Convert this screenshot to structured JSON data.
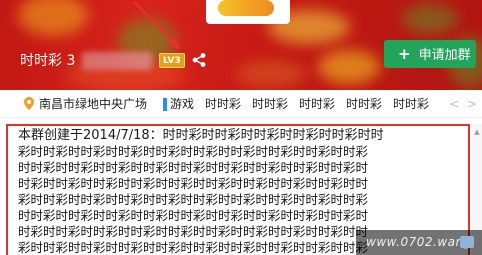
{
  "group": {
    "name_prefix": "时时彩 3",
    "level": "LV3",
    "join_label": "申请加群"
  },
  "tags": {
    "location": "南昌市绿地中央广场",
    "items": [
      "游戏",
      "时时彩",
      "时时彩",
      "时时彩",
      "时时彩",
      "时时彩"
    ],
    "prev": "<",
    "next": ">"
  },
  "description": {
    "lines": [
      "本群创建于2014/7/18：时时彩时时彩时时彩时时彩时时彩时时",
      "彩时时彩时时彩时时彩时时彩时时彩时时彩时时彩时时彩时时彩",
      "时时彩时时彩时时彩时时彩时时彩时时彩时时彩时时彩时时彩时",
      "时彩时时彩时时彩时时彩时时彩时时彩时时彩时时彩时时彩时时",
      "彩时时彩时时彩时时彩时时彩时时彩时时彩时时彩时时彩时时彩",
      "时时彩时时彩时时彩时时彩时时彩时时彩时时彩时时彩时时彩时",
      "时彩时时彩时时彩时时彩时时彩时时彩时时彩时时彩时时彩时时",
      "彩时时彩时时彩时时彩时时彩时时彩时时彩时时彩时时彩时时彩"
    ]
  },
  "watermark": "www.0702.wang",
  "colors": {
    "accent_green": "#22a55b",
    "highlight_red": "#e0332b",
    "level_badge": "#e6a017",
    "tag_blue": "#2a8ee6"
  }
}
